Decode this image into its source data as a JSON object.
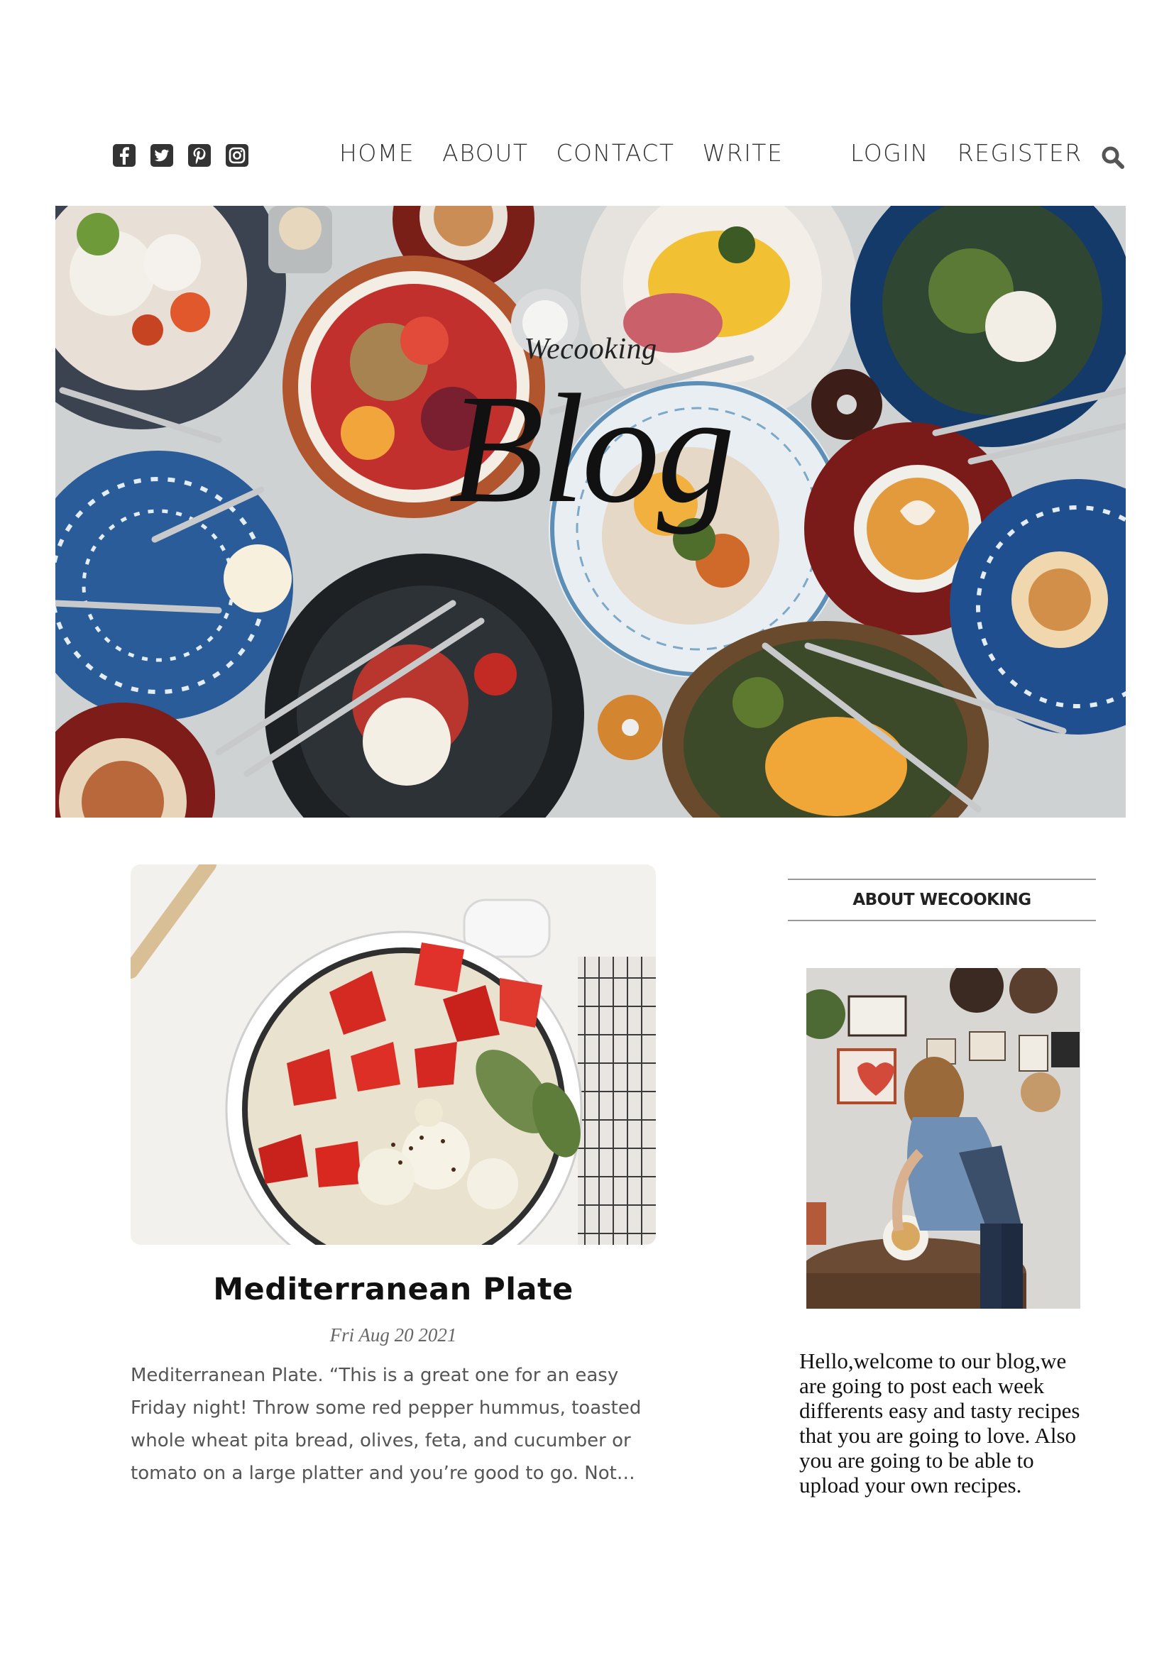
{
  "social": {
    "icons": [
      "facebook-icon",
      "twitter-icon",
      "pinterest-icon",
      "instagram-icon"
    ]
  },
  "nav": {
    "items": [
      "HOME",
      "ABOUT",
      "CONTACT",
      "WRITE"
    ],
    "auth": [
      "LOGIN",
      "REGISTER"
    ],
    "search_icon": "search-icon"
  },
  "hero": {
    "small": "Wecooking",
    "big": "Blog"
  },
  "post": {
    "title": "Mediterranean Plate",
    "date": "Fri Aug 20 2021",
    "excerpt": "Mediterranean Plate. “This is a great one for an easy Friday night! Throw some red pepper hummus, toasted whole wheat pita bread, olives, feta, and cucumber or tomato on a large platter and you’re good to go. Not…"
  },
  "sidebar": {
    "title": "ABOUT WECOOKING",
    "text": "Hello,welcome to our blog,we are going to post each week differents easy and tasty recipes that you are going to love. Also you are going to be able to upload your own recipes."
  },
  "colors": {
    "text": "#222222",
    "muted": "#555555",
    "rule": "#999999",
    "icon": "#333333"
  }
}
